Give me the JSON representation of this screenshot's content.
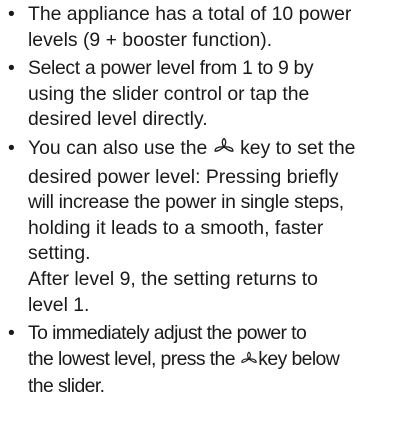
{
  "bullet_symbol": "•",
  "icons": {
    "fan_key": "fan-icon"
  },
  "bullets": [
    {
      "line1": "The appliance has a total of 10 power",
      "line2": "levels (9 + booster function)."
    },
    {
      "line1": "Select a power level from 1 to 9 by",
      "line2": "using the slider control or tap the",
      "line3": "desired level directly."
    },
    {
      "pre_icon": "You can also use the",
      "post_icon": "key to set the",
      "line2": "desired power level: Pressing briefly",
      "line3": "will increase the power in single steps,",
      "line4": "holding it leads to a smooth, faster",
      "line5": "setting.",
      "line6": "After level 9, the setting returns to",
      "line7": "level 1."
    },
    {
      "line1": "To immediately adjust the power to",
      "pre_icon": "the lowest level, press the",
      "post_icon": "key below",
      "line3": "the slider."
    }
  ]
}
